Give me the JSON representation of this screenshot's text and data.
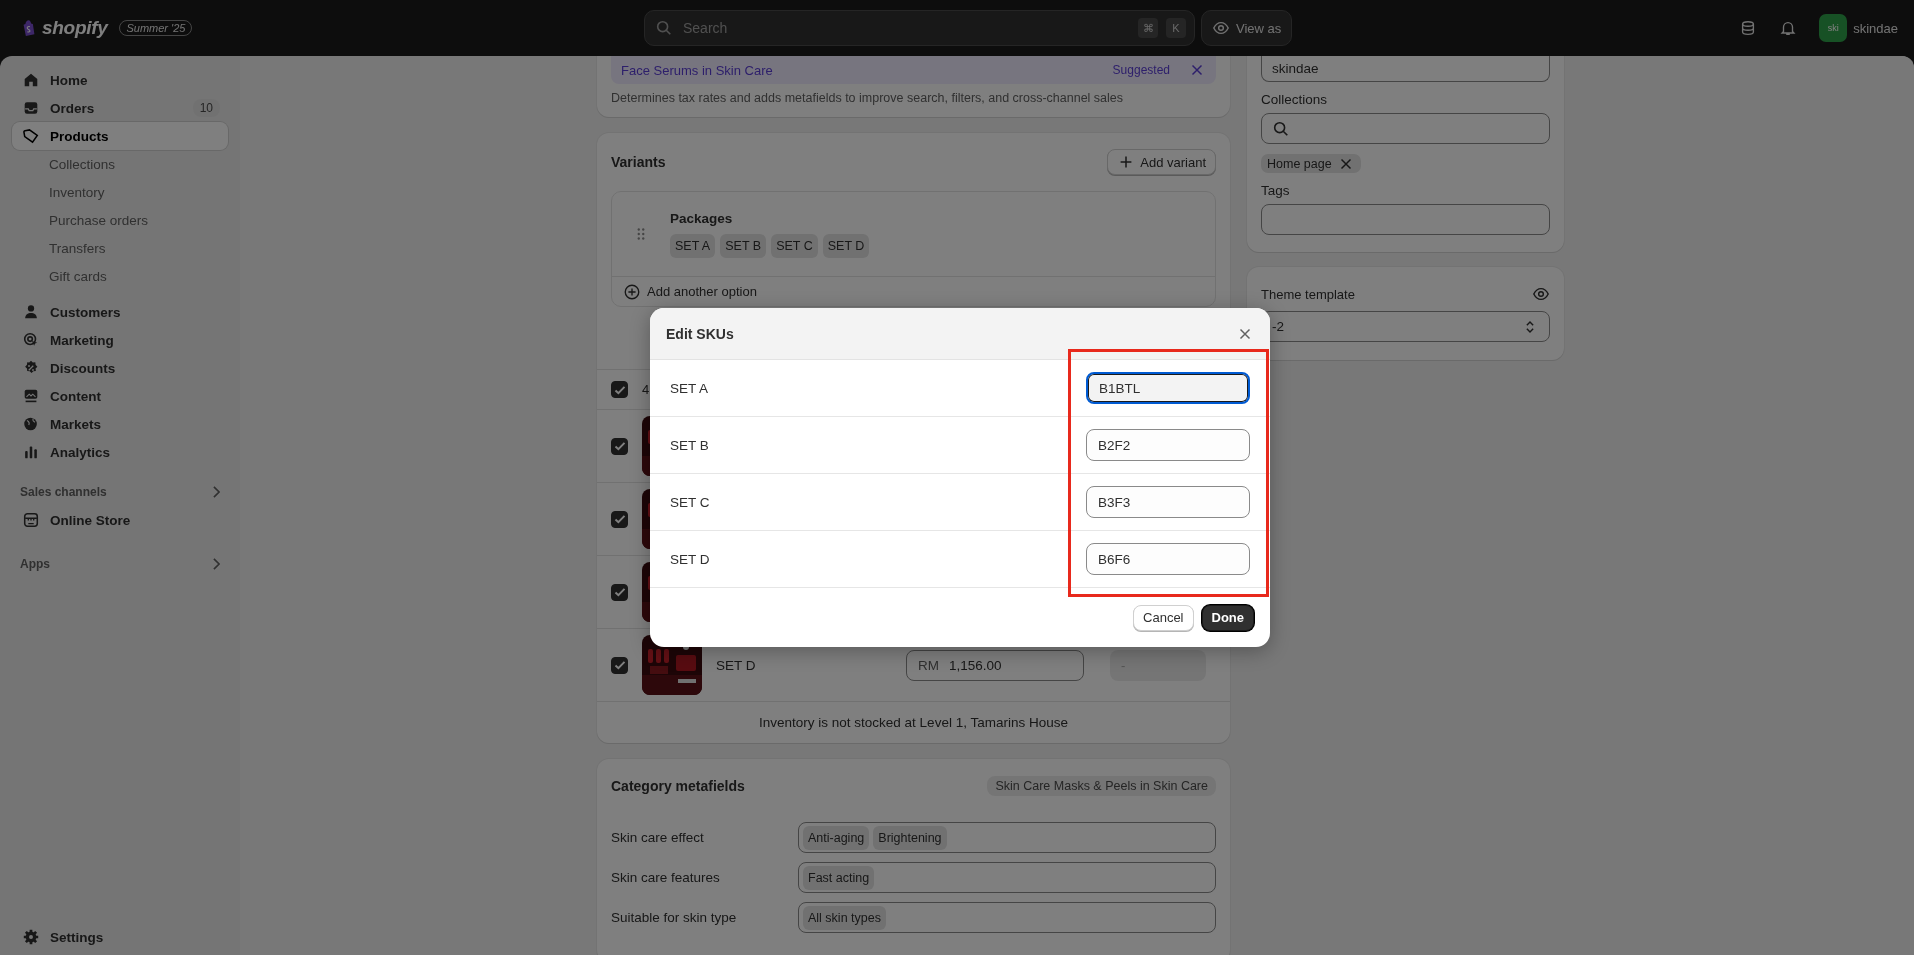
{
  "topbar": {
    "logo": "shopify",
    "edition": "Summer '25",
    "search": {
      "placeholder": "Search",
      "keys": [
        "⌘",
        "K"
      ]
    },
    "view_as": "View as",
    "store": {
      "initials": "ski",
      "name": "skindae"
    }
  },
  "sidebar": {
    "items": [
      {
        "label": "Home",
        "selected": false
      },
      {
        "label": "Orders",
        "badge": "10",
        "selected": false
      },
      {
        "label": "Products",
        "selected": true,
        "children": [
          {
            "label": "Collections",
            "selected": false
          },
          {
            "label": "Inventory",
            "selected": false
          },
          {
            "label": "Purchase orders",
            "selected": false
          },
          {
            "label": "Transfers",
            "selected": false
          },
          {
            "label": "Gift cards",
            "selected": false
          }
        ]
      },
      {
        "label": "Customers",
        "selected": false
      },
      {
        "label": "Marketing",
        "selected": false
      },
      {
        "label": "Discounts",
        "selected": false
      },
      {
        "label": "Content",
        "selected": false
      },
      {
        "label": "Markets",
        "selected": false
      },
      {
        "label": "Analytics",
        "selected": false
      }
    ],
    "sales_channels": {
      "title": "Sales channels",
      "items": [
        {
          "label": "Online Store",
          "selected": false
        }
      ]
    },
    "apps": {
      "title": "Apps"
    },
    "settings": {
      "label": "Settings"
    }
  },
  "category_card": {
    "suggestion": "Face Serums in Skin Care",
    "suggestion_status": "Suggested",
    "description": "Determines tax rates and adds metafields to improve search, filters, and cross-channel sales"
  },
  "variants": {
    "title": "Variants",
    "add_button": "Add variant",
    "options": [
      {
        "name": "Packages",
        "values": [
          "SET A",
          "SET B",
          "SET C",
          "SET D"
        ]
      }
    ],
    "add_option": "Add another option",
    "header": {
      "checked": true,
      "text": "4"
    },
    "rows": [
      {
        "checked": true
      },
      {
        "checked": true
      },
      {
        "checked": true
      },
      {
        "checked": true,
        "name": "SET D",
        "price_prefix": "RM",
        "price": "1,156.00",
        "available": "-"
      }
    ],
    "footer": "Inventory is not stocked at Level 1, Tamarins House"
  },
  "metafields": {
    "title": "Category metafields",
    "category": "Skin Care Masks & Peels in Skin Care",
    "fields": [
      {
        "label": "Skin care effect",
        "values": [
          "Anti-aging",
          "Brightening"
        ]
      },
      {
        "label": "Skin care features",
        "values": [
          "Fast acting"
        ]
      },
      {
        "label": "Suitable for skin type",
        "values": [
          "All skin types"
        ]
      }
    ]
  },
  "organization": {
    "vendor": "skindae",
    "collections_label": "Collections",
    "collections": [
      "Home page"
    ],
    "tags_label": "Tags"
  },
  "theme": {
    "label": "Theme template",
    "value": "-2"
  },
  "modal": {
    "title": "Edit SKUs",
    "highlighted": true,
    "rows": [
      {
        "label": "SET A",
        "sku": "B1BTL",
        "focused": true
      },
      {
        "label": "SET B",
        "sku": "B2F2",
        "focused": false
      },
      {
        "label": "SET C",
        "sku": "B3F3",
        "focused": false
      },
      {
        "label": "SET D",
        "sku": "B6F6",
        "focused": false
      }
    ],
    "cancel": "Cancel",
    "done": "Done"
  }
}
